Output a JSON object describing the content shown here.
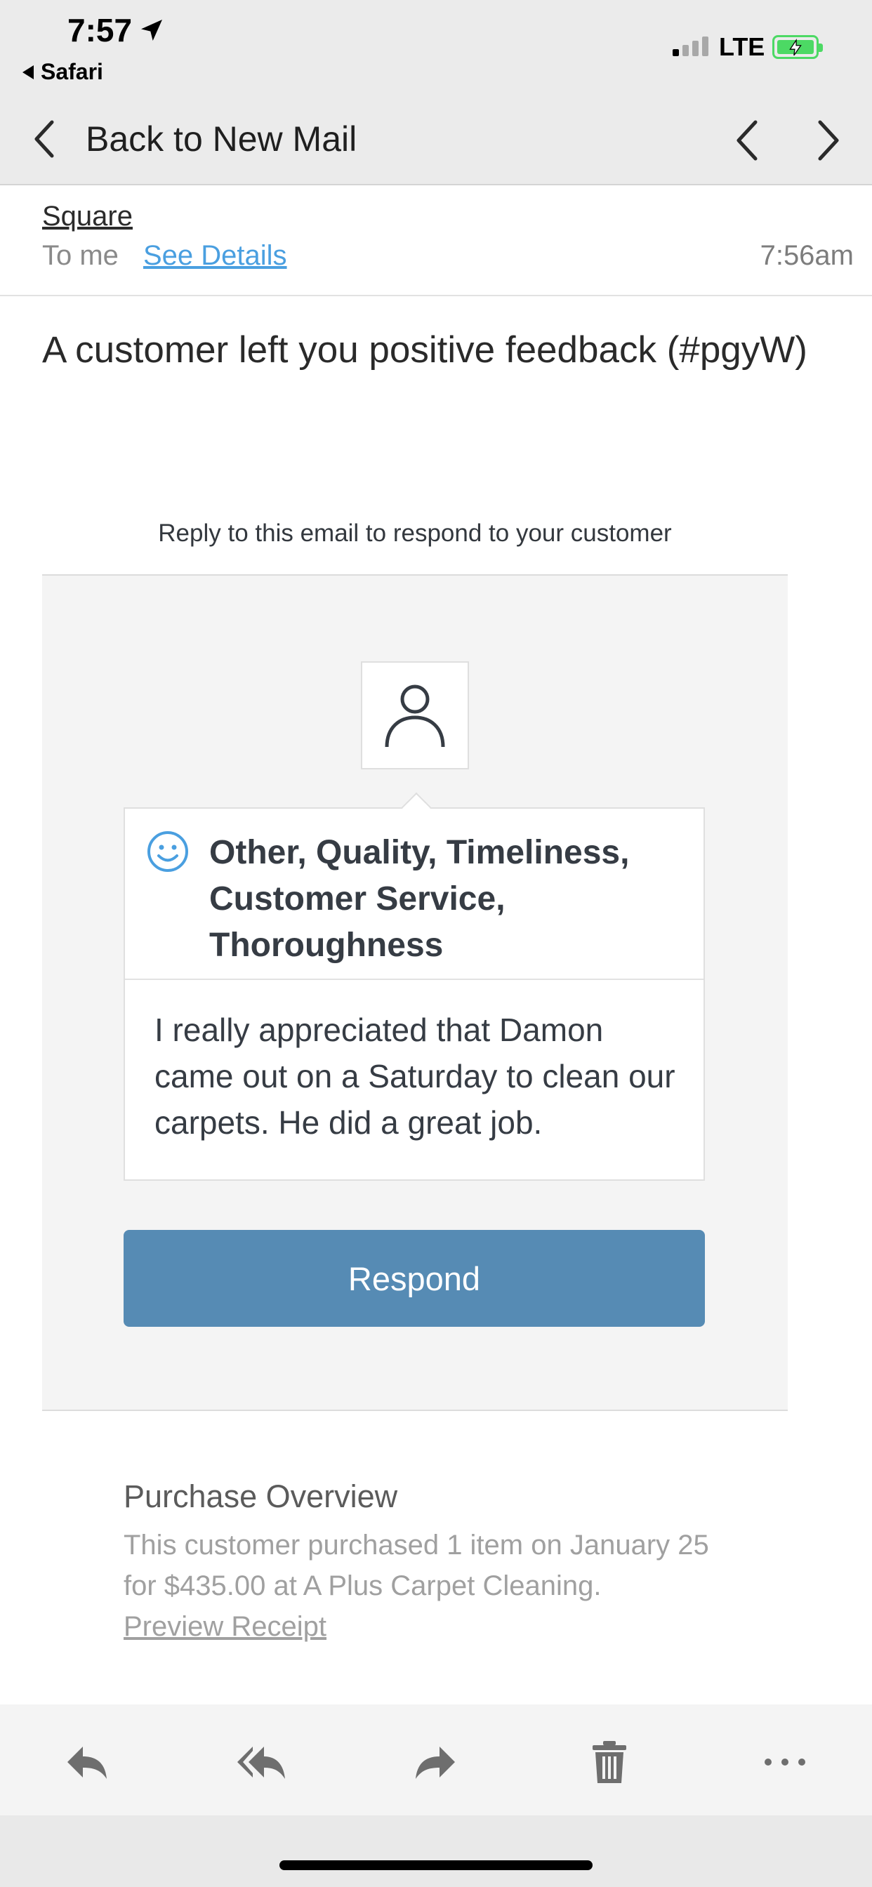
{
  "status_bar": {
    "time": "7:57",
    "back_app": "Safari",
    "network": "LTE"
  },
  "nav": {
    "back_label": "Back to New Mail"
  },
  "email": {
    "sender": "Square",
    "recipient": "To me",
    "details_link": "See Details",
    "time": "7:56am",
    "subject": "A customer left you positive feedback (#pgyW)",
    "reply_note": "Reply to this email to respond to your customer",
    "feedback": {
      "categories": "Other, Quality, Timeliness, Customer Service, Thoroughness",
      "comment": "I really appreciated that Damon came out on a Saturday to clean our carpets. He did a great job."
    },
    "respond_label": "Respond",
    "purchase": {
      "title": "Purchase Overview",
      "text": "This customer purchased 1 item on January 25 for $435.00 at A Plus Carpet Cleaning.",
      "link": "Preview Receipt"
    }
  },
  "toolbar": {
    "icons": [
      "reply-icon",
      "reply-all-icon",
      "forward-icon",
      "trash-icon",
      "more-icon"
    ]
  },
  "colors": {
    "accent_link": "#4a9fe0",
    "respond_button": "#568bb4",
    "battery": "#4cd964"
  }
}
